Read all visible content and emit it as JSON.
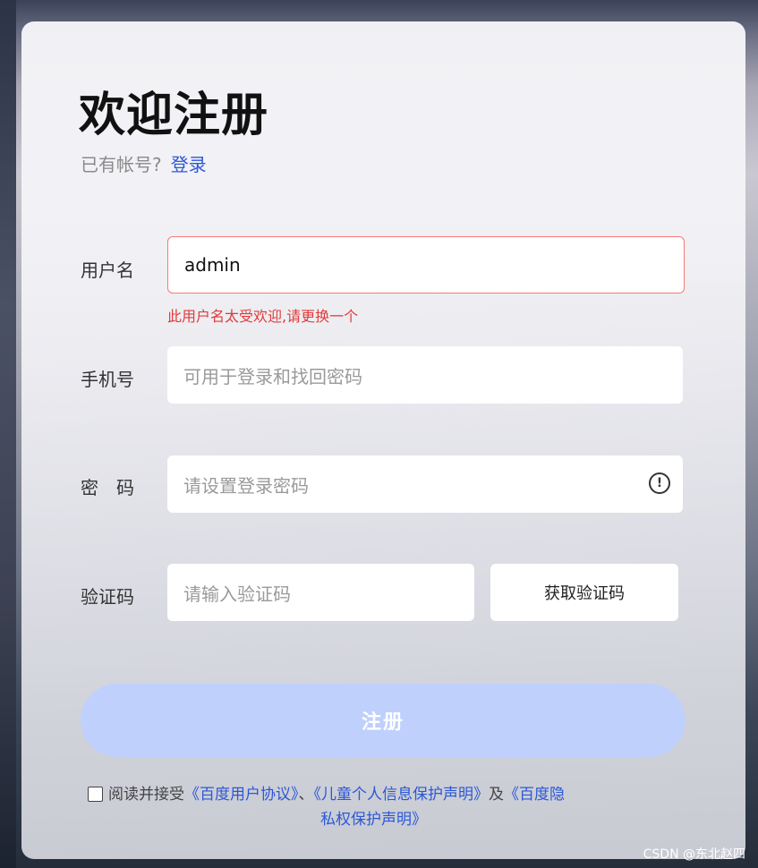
{
  "page": {
    "title": "欢迎注册",
    "has_account_text": "已有帐号?",
    "login_link": "登录"
  },
  "form": {
    "username": {
      "label": "用户名",
      "value": "admin",
      "error": "此用户名太受欢迎,请更换一个"
    },
    "phone": {
      "label": "手机号",
      "placeholder": "可用于登录和找回密码"
    },
    "password": {
      "label": "密　码",
      "placeholder": "请设置登录密码",
      "icon": "info-icon"
    },
    "code": {
      "label": "验证码",
      "placeholder": "请输入验证码",
      "get_code_label": "获取验证码"
    },
    "submit_label": "注册"
  },
  "agreement": {
    "prefix": "阅读并接受",
    "link1": "《百度用户协议》",
    "sep": "、",
    "link2": "《儿童个人信息保护声明》",
    "and": "及",
    "link3a": "《百度隐",
    "link3b": "私权保护声明》"
  },
  "watermark": "CSDN @东北赵四",
  "colors": {
    "link": "#2b57d7",
    "error": "#e23a3a",
    "submit_bg": "#bfd0fc"
  }
}
